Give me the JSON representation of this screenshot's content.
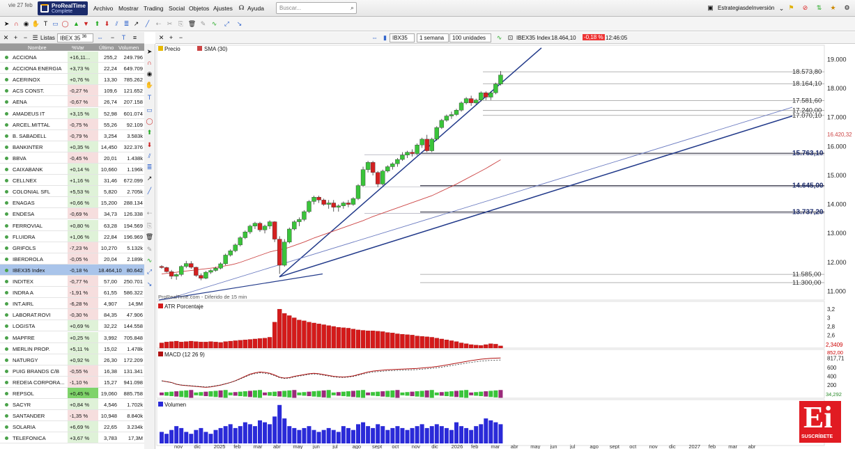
{
  "topbar": {
    "date": "vie 27 feb",
    "brand1": "ProRealTime",
    "brand2": "Complete",
    "menus": [
      "Archivo",
      "Mostrar",
      "Trading",
      "Social",
      "Objetos",
      "Ajustes",
      "Ayuda"
    ],
    "search_placeholder": "Buscar...",
    "account": "EstrategiasdeInversión"
  },
  "watchlist": {
    "tab": "Listas",
    "list": "IBEX 35",
    "list_count": "36",
    "columns": [
      "Nombre",
      "%Var",
      "Último",
      "Volumen"
    ],
    "rows": [
      {
        "name": "ACCIONA",
        "chg": "+16,11...",
        "last": "255,2",
        "vol": "249.796",
        "dir": "up"
      },
      {
        "name": "ACCIONA ENERGIA",
        "chg": "+3,73 %",
        "last": "22,24",
        "vol": "649.709",
        "dir": "up"
      },
      {
        "name": "ACERINOX",
        "chg": "+0,76 %",
        "last": "13,30",
        "vol": "785.262",
        "dir": "up"
      },
      {
        "name": "ACS CONST.",
        "chg": "-0,27 %",
        "last": "109,6",
        "vol": "121.652",
        "dir": "down"
      },
      {
        "name": "AENA",
        "chg": "-0,67 %",
        "last": "26,74",
        "vol": "207.158",
        "dir": "down"
      },
      {
        "name": "AMADEUS IT",
        "chg": "+3,15 %",
        "last": "52,98",
        "vol": "601.074",
        "dir": "up"
      },
      {
        "name": "ARCEL.MITTAL",
        "chg": "-0,75 %",
        "last": "55,26",
        "vol": "92.109",
        "dir": "down"
      },
      {
        "name": "B. SABADELL",
        "chg": "-0,79 %",
        "last": "3,254",
        "vol": "3.583k",
        "dir": "down"
      },
      {
        "name": "BANKINTER",
        "chg": "+0,35 %",
        "last": "14,450",
        "vol": "322.376",
        "dir": "up"
      },
      {
        "name": "BBVA",
        "chg": "-0,45 %",
        "last": "20,01",
        "vol": "1.438k",
        "dir": "down"
      },
      {
        "name": "CAIXABANK",
        "chg": "+0,14 %",
        "last": "10,660",
        "vol": "1.196k",
        "dir": "up"
      },
      {
        "name": "CELLNEX",
        "chg": "+1,16 %",
        "last": "31,46",
        "vol": "672.099",
        "dir": "up"
      },
      {
        "name": "COLONIAL SFL",
        "chg": "+5,53 %",
        "last": "5,820",
        "vol": "2.705k",
        "dir": "up"
      },
      {
        "name": "ENAGAS",
        "chg": "+0,66 %",
        "last": "15,200",
        "vol": "288.134",
        "dir": "up"
      },
      {
        "name": "ENDESA",
        "chg": "-0,69 %",
        "last": "34,73",
        "vol": "126.338",
        "dir": "down"
      },
      {
        "name": "FERROVIAL",
        "chg": "+0,80 %",
        "last": "63,28",
        "vol": "194.569",
        "dir": "up"
      },
      {
        "name": "FLUIDRA",
        "chg": "+1,06 %",
        "last": "22,84",
        "vol": "196.969",
        "dir": "up"
      },
      {
        "name": "GRIFOLS",
        "chg": "-7,23 %",
        "last": "10,270",
        "vol": "5.132k",
        "dir": "down"
      },
      {
        "name": "IBERDROLA",
        "chg": "-0,05 %",
        "last": "20,04",
        "vol": "2.189k",
        "dir": "down"
      },
      {
        "name": "IBEX35 Index",
        "chg": "-0,18 %",
        "last": "18.464,10",
        "vol": "80.642",
        "dir": "sel"
      },
      {
        "name": "INDITEX",
        "chg": "-0,77 %",
        "last": "57,00",
        "vol": "250.701",
        "dir": "down"
      },
      {
        "name": "INDRA A",
        "chg": "-1,91 %",
        "last": "61,55",
        "vol": "586.322",
        "dir": "down"
      },
      {
        "name": "INT.AIRL",
        "chg": "-6,28 %",
        "last": "4,907",
        "vol": "14,9M",
        "dir": "down"
      },
      {
        "name": "LABORAT.ROVI",
        "chg": "-0,30 %",
        "last": "84,35",
        "vol": "47.906",
        "dir": "down"
      },
      {
        "name": "LOGISTA",
        "chg": "+0,69 %",
        "last": "32,22",
        "vol": "144.558",
        "dir": "up"
      },
      {
        "name": "MAPFRE",
        "chg": "+0,25 %",
        "last": "3,992",
        "vol": "705.848",
        "dir": "up"
      },
      {
        "name": "MERLIN PROP.",
        "chg": "+5,11 %",
        "last": "15,02",
        "vol": "1.478k",
        "dir": "up"
      },
      {
        "name": "NATURGY",
        "chg": "+0,92 %",
        "last": "26,30",
        "vol": "172.209",
        "dir": "up"
      },
      {
        "name": "PUIG BRANDS C/B",
        "chg": "-0,55 %",
        "last": "16,38",
        "vol": "131.341",
        "dir": "down"
      },
      {
        "name": "REDEIA CORPORA...",
        "chg": "-1,10 %",
        "last": "15,27",
        "vol": "941.098",
        "dir": "down"
      },
      {
        "name": "REPSOL",
        "chg": "+0,45 %",
        "last": "19,060",
        "vol": "885.758",
        "dir": "upstrong"
      },
      {
        "name": "SACYR",
        "chg": "+0,84 %",
        "last": "4,546",
        "vol": "1.702k",
        "dir": "up"
      },
      {
        "name": "SANTANDER",
        "chg": "-1,35 %",
        "last": "10,948",
        "vol": "8.840k",
        "dir": "down"
      },
      {
        "name": "SOLARIA",
        "chg": "+6,69 %",
        "last": "22,65",
        "vol": "3.234k",
        "dir": "up"
      },
      {
        "name": "TELEFONICA",
        "chg": "+3,67 %",
        "last": "3,783",
        "vol": "17,3M",
        "dir": "up"
      }
    ]
  },
  "chart_header": {
    "symbol": "IBX35",
    "period": "1 semana",
    "units": "100 unidades",
    "instrument": "IBEX35 Index",
    "price": "18.464,10",
    "change": "-0,18 %",
    "time": "12:46:05"
  },
  "panes": {
    "price_label": "Precio",
    "sma_label": "SMA (30)",
    "atr_label": "ATR Porcentaje",
    "macd_label": "MACD (12 26 9)",
    "vol_label": "Volumen",
    "watermark": "ProRealTime.com - Diferido de 15 min"
  },
  "price_axis": {
    "ticks": [
      "19.000",
      "18.000",
      "17.000",
      "16.000",
      "15.000",
      "14.000",
      "13.000",
      "12.000",
      "11.000"
    ],
    "levels": [
      {
        "label": "18.573,80",
        "bold": false
      },
      {
        "label": "18.164,10",
        "bold": false
      },
      {
        "label": "17.581,60",
        "bold": false
      },
      {
        "label": "17.240,00",
        "bold": false
      },
      {
        "label": "17.070,10",
        "bold": false
      },
      {
        "label": "15.763,10",
        "bold": true
      },
      {
        "label": "14.645,00",
        "bold": true
      },
      {
        "label": "13.737,20",
        "bold": true
      },
      {
        "label": "11.585,00",
        "bold": false
      },
      {
        "label": "11.300,00",
        "bold": false
      }
    ],
    "sma_tag": "16.420,32"
  },
  "atr_axis": {
    "ticks": [
      "3,2",
      "3",
      "2,8",
      "2,6"
    ],
    "current": "2,3409"
  },
  "macd_axis": {
    "ticks": [
      "817,71",
      "600",
      "400",
      "200"
    ],
    "top": "852,00",
    "bottom": "34,292"
  },
  "vol_axis": {
    "ticks": [
      "20M",
      "10M"
    ]
  },
  "time_axis": [
    "nov",
    "dic",
    "2025",
    "feb",
    "mar",
    "abr",
    "may",
    "jun",
    "jul",
    "ago",
    "sept",
    "oct",
    "nov",
    "dic",
    "2026",
    "feb",
    "mar",
    "abr",
    "may",
    "jun",
    "jul",
    "ago",
    "sept",
    "oct",
    "nov",
    "dic",
    "2027",
    "feb",
    "mar",
    "abr"
  ],
  "ei_logo": {
    "text": "Ei",
    "sub": "SUSCRÍBETE"
  },
  "chart_data": {
    "type": "candlestick",
    "title": "IBEX35 Index",
    "period": "1 semana",
    "weeks": [
      [
        11860,
        11900,
        11780,
        11820
      ],
      [
        11820,
        11850,
        11650,
        11680
      ],
      [
        11680,
        11740,
        11420,
        11520
      ],
      [
        11520,
        11620,
        11400,
        11580
      ],
      [
        11580,
        11900,
        11520,
        11860
      ],
      [
        11860,
        12050,
        11800,
        11960
      ],
      [
        11960,
        12040,
        11780,
        11830
      ],
      [
        11830,
        11850,
        11500,
        11550
      ],
      [
        11550,
        11620,
        11380,
        11450
      ],
      [
        11450,
        11700,
        11420,
        11660
      ],
      [
        11660,
        11760,
        11600,
        11720
      ],
      [
        11720,
        11850,
        11680,
        11800
      ],
      [
        11800,
        12000,
        11760,
        11950
      ],
      [
        11950,
        12300,
        11900,
        12250
      ],
      [
        12250,
        12450,
        12200,
        12400
      ],
      [
        12400,
        12650,
        12350,
        12600
      ],
      [
        12600,
        12900,
        12550,
        12850
      ],
      [
        12850,
        13100,
        12800,
        13050
      ],
      [
        13050,
        13300,
        12980,
        13250
      ],
      [
        13250,
        13400,
        13150,
        13350
      ],
      [
        13350,
        13400,
        13050,
        13120
      ],
      [
        13120,
        13300,
        13000,
        13250
      ],
      [
        13250,
        13450,
        13150,
        13400
      ],
      [
        13400,
        13420,
        12700,
        12800
      ],
      [
        12800,
        12900,
        11600,
        11900
      ],
      [
        11900,
        12800,
        11850,
        12700
      ],
      [
        12700,
        13200,
        12650,
        13150
      ],
      [
        13150,
        13450,
        13100,
        13400
      ],
      [
        13400,
        13550,
        13250,
        13480
      ],
      [
        13480,
        13800,
        13420,
        13750
      ],
      [
        13750,
        14150,
        13700,
        14100
      ],
      [
        14100,
        14300,
        14000,
        14250
      ],
      [
        14250,
        14300,
        14050,
        14150
      ],
      [
        14150,
        14200,
        13950,
        14000
      ],
      [
        14000,
        14150,
        13850,
        14050
      ],
      [
        14050,
        14150,
        13750,
        13900
      ],
      [
        13900,
        14000,
        13750,
        13950
      ],
      [
        13950,
        14100,
        13850,
        14050
      ],
      [
        14050,
        14150,
        13900,
        14000
      ],
      [
        14000,
        14250,
        13950,
        14200
      ],
      [
        14200,
        14700,
        14150,
        14650
      ],
      [
        14650,
        15300,
        14600,
        15200
      ],
      [
        15200,
        15500,
        15100,
        15450
      ],
      [
        15450,
        15500,
        15000,
        15100
      ],
      [
        15100,
        15150,
        14600,
        14700
      ],
      [
        14700,
        15200,
        14650,
        15150
      ],
      [
        15150,
        15350,
        15100,
        15300
      ],
      [
        15300,
        15450,
        15200,
        15400
      ],
      [
        15400,
        15600,
        15300,
        15550
      ],
      [
        15550,
        15800,
        15500,
        15700
      ],
      [
        15700,
        15850,
        15600,
        15800
      ],
      [
        15800,
        15900,
        15650,
        15750
      ],
      [
        15750,
        16100,
        15700,
        16050
      ],
      [
        16050,
        16300,
        15950,
        16250
      ],
      [
        16250,
        16400,
        15800,
        15850
      ],
      [
        15850,
        16300,
        15800,
        16250
      ],
      [
        16250,
        16700,
        16200,
        16650
      ],
      [
        16650,
        16950,
        16600,
        16900
      ],
      [
        16900,
        17100,
        16850,
        17050
      ],
      [
        17050,
        17200,
        16950,
        17100
      ],
      [
        17100,
        17300,
        17050,
        17250
      ],
      [
        17250,
        17550,
        17200,
        17500
      ],
      [
        17500,
        17700,
        17450,
        17650
      ],
      [
        17650,
        17750,
        17400,
        17500
      ],
      [
        17500,
        17650,
        17450,
        17600
      ],
      [
        17600,
        17900,
        17550,
        17850
      ],
      [
        17850,
        17900,
        17600,
        17700
      ],
      [
        17700,
        17900,
        17600,
        17850
      ],
      [
        17850,
        18200,
        17800,
        18150
      ],
      [
        18150,
        18600,
        18100,
        18464
      ]
    ],
    "sma30": [
      11600,
      11620,
      11640,
      11660,
      11680,
      11700,
      11720,
      11740,
      11760,
      11780,
      11800,
      11820,
      11850,
      11880,
      11910,
      11950,
      12000,
      12060,
      12120,
      12180,
      12240,
      12300,
      12360,
      12400,
      12430,
      12470,
      12520,
      12580,
      12640,
      12700,
      12770,
      12840,
      12900,
      12960,
      13020,
      13080,
      13140,
      13200,
      13260,
      13320,
      13380,
      13440,
      13510,
      13580,
      13640,
      13700,
      13760,
      13820,
      13880,
      13940,
      14000,
      14060,
      14120,
      14180,
      14240,
      14300,
      14380,
      14460,
      14540,
      14620,
      14700,
      14790,
      14880,
      14970,
      15060,
      15150,
      15240,
      15340,
      15440,
      15540
    ],
    "atr": [
      2.42,
      2.44,
      2.45,
      2.46,
      2.44,
      2.45,
      2.46,
      2.45,
      2.44,
      2.44,
      2.45,
      2.44,
      2.43,
      2.45,
      2.46,
      2.47,
      2.48,
      2.49,
      2.5,
      2.51,
      2.52,
      2.53,
      2.55,
      2.9,
      3.2,
      3.1,
      3.05,
      3.0,
      2.95,
      2.93,
      2.9,
      2.88,
      2.86,
      2.84,
      2.82,
      2.8,
      2.78,
      2.77,
      2.76,
      2.74,
      2.72,
      2.71,
      2.7,
      2.7,
      2.69,
      2.68,
      2.66,
      2.65,
      2.63,
      2.62,
      2.61,
      2.6,
      2.58,
      2.57,
      2.56,
      2.55,
      2.53,
      2.51,
      2.49,
      2.47,
      2.45,
      2.42,
      2.4,
      2.38,
      2.37,
      2.36,
      2.38,
      2.4,
      2.39,
      2.35
    ],
    "macd": [
      300,
      280,
      260,
      220,
      200,
      190,
      180,
      170,
      160,
      150,
      160,
      180,
      200,
      230,
      260,
      300,
      350,
      400,
      450,
      480,
      500,
      490,
      470,
      430,
      380,
      360,
      370,
      400,
      420,
      440,
      460,
      470,
      460,
      440,
      420,
      400,
      390,
      385,
      395,
      410,
      440,
      470,
      500,
      520,
      530,
      540,
      550,
      555,
      560,
      565,
      570,
      575,
      580,
      590,
      600,
      610,
      625,
      640,
      660,
      680,
      700,
      720,
      740,
      760,
      775,
      790,
      800,
      810,
      815,
      818
    ],
    "volume": [
      6,
      5,
      7,
      9,
      8,
      6,
      5,
      7,
      8,
      6,
      5,
      7,
      8,
      9,
      10,
      8,
      9,
      11,
      10,
      9,
      12,
      11,
      10,
      14,
      20,
      13,
      9,
      8,
      7,
      8,
      9,
      7,
      6,
      7,
      8,
      7,
      6,
      9,
      8,
      7,
      10,
      11,
      9,
      8,
      10,
      9,
      7,
      8,
      9,
      8,
      7,
      8,
      9,
      10,
      8,
      9,
      10,
      9,
      8,
      7,
      11,
      9,
      8,
      7,
      9,
      10,
      13,
      12,
      11,
      10
    ]
  }
}
